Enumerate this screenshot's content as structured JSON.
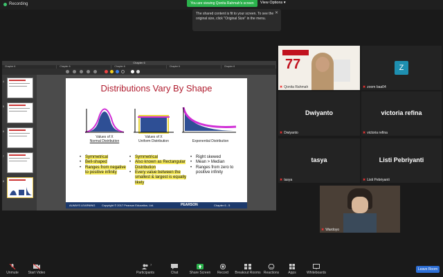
{
  "topbar": {
    "recording_label": "Recording",
    "viewing_banner": "You are viewing Qonita Rahmah's screen",
    "view_options": "View Options"
  },
  "tooltip": {
    "text": "The shared content is fit to your screen. To see the original size, click \"Original Size\" in the menu."
  },
  "share": {
    "window_title": "Chapter 6",
    "tabs": [
      "Chapter 6",
      "Chapter 6",
      "Chapter 6",
      "Chapter 6",
      "Chapter 6"
    ],
    "thumbnails": [
      {
        "num": "4"
      },
      {
        "num": "5"
      },
      {
        "num": "6"
      },
      {
        "num": "7"
      },
      {
        "num": "8"
      }
    ],
    "slide": {
      "title": "Distributions Vary By Shape",
      "captions": [
        {
          "l1": "Values of X",
          "l2": "Normal Distribution"
        },
        {
          "l1": "Values of X",
          "l2": "Uniform Distribution"
        },
        {
          "l1": "",
          "l2": "Exponential Distribution"
        }
      ],
      "col1": [
        "Symmetrical",
        "Bell-shaped",
        "Ranges from negative to positive infinity"
      ],
      "col2": [
        "Symmetrical",
        "Also known as Rectangular Distribution",
        "Every value between the smallest & largest is equally likely"
      ],
      "col3": [
        "Right skewed",
        "Mean > Median",
        "Ranges from zero to positive infinity"
      ],
      "footer_left": "ALWAYS LEARNING",
      "footer_copy": "Copyright © 2017 Pearson Education, Ltd.",
      "footer_brand": "PEARSON",
      "footer_page": "Chapter 6 - 5"
    }
  },
  "participants": [
    {
      "name": "Qonita Rahmah",
      "type": "video"
    },
    {
      "name": "zoom baa04",
      "type": "initial",
      "initial": "Z",
      "color": "#1e8fb0"
    },
    {
      "name": "Dwiyanto",
      "type": "name"
    },
    {
      "name": "victoria refina",
      "type": "name"
    },
    {
      "name": "tasya",
      "type": "name"
    },
    {
      "name": "Listi Pebriyanti",
      "type": "name"
    },
    {
      "name": "Wardoyo",
      "type": "video"
    }
  ],
  "bottombar": {
    "items": [
      "Unmute",
      "Start Video",
      "Participants",
      "Chat",
      "Share Screen",
      "Record",
      "Breakout Rooms",
      "Reactions",
      "Apps",
      "Whiteboards"
    ],
    "participants_count": "7",
    "leave": "Leave Room"
  },
  "colors": {
    "share_green": "#2bb24c",
    "leave_blue": "#2d6fd6",
    "slide_title": "#b01c2e",
    "highlight": "#f6ea5a"
  }
}
